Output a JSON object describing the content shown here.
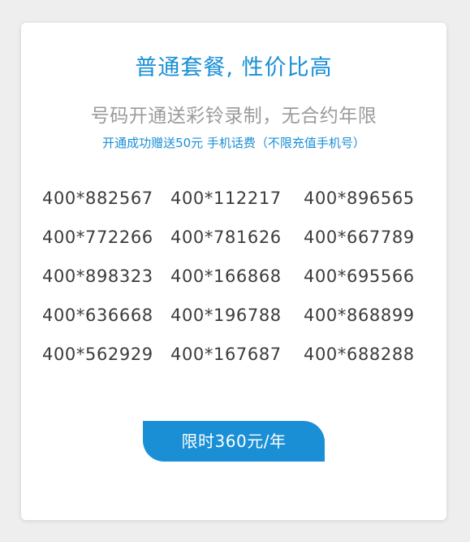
{
  "card": {
    "title": "普通套餐, 性价比高",
    "subtitle": "号码开通送彩铃录制，无合约年限",
    "promo": "开通成功赠送50元 手机话费（不限充值手机号）",
    "numbers": [
      [
        "400*882567",
        "400*112217",
        "400*896565"
      ],
      [
        "400*772266",
        "400*781626",
        "400*667789"
      ],
      [
        "400*898323",
        "400*166868",
        "400*695566"
      ],
      [
        "400*636668",
        "400*196788",
        "400*868899"
      ],
      [
        "400*562929",
        "400*167687",
        "400*688288"
      ]
    ],
    "price_label": "限时360元/年"
  },
  "colors": {
    "accent": "#1a8fd6",
    "muted_text": "#9b9b9b",
    "number_text": "#3c3c3c",
    "background": "#eeeeee",
    "card": "#ffffff"
  }
}
